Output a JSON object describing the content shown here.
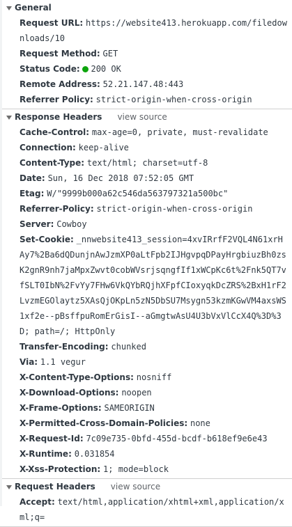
{
  "general": {
    "title": "General",
    "rows": [
      {
        "key": "Request URL:",
        "value": "https://website413.herokuapp.com/filedownloads/10"
      },
      {
        "key": "Request Method:",
        "value": "GET"
      },
      {
        "key": "Status Code:",
        "value": "200 OK"
      },
      {
        "key": "Remote Address:",
        "value": "52.21.147.48:443"
      },
      {
        "key": "Referrer Policy:",
        "value": "strict-origin-when-cross-origin"
      }
    ]
  },
  "response_headers": {
    "title": "Response Headers",
    "view_source": "view source",
    "rows": [
      {
        "key": "Cache-Control:",
        "value": "max-age=0, private, must-revalidate"
      },
      {
        "key": "Connection:",
        "value": "keep-alive"
      },
      {
        "key": "Content-Type:",
        "value": "text/html; charset=utf-8"
      },
      {
        "key": "Date:",
        "value": "Sun, 16 Dec 2018 07:52:05 GMT"
      },
      {
        "key": "Etag:",
        "value": "W/\"9999b000a62c546da563797321a500bc\""
      },
      {
        "key": "Referrer-Policy:",
        "value": "strict-origin-when-cross-origin"
      },
      {
        "key": "Server:",
        "value": "Cowboy"
      },
      {
        "key": "Set-Cookie:",
        "value": "_nnwebsite413_session=4xvIRrfF2VQL4N61xrHAy7%2Ba6dQDunjnAwJzmXP0aLtFpb2IJHgvpqDPayHrgbiuzBh0zsK2gnR9nh7jaMpxZwvt0cobWVsrjsqngfIf1xWCpKc6t%2Fnk5QT7vfSLT0IbN%2FvYy7FHw6VkQYbRQjhXFpfCIoxyqkDcZRS%2BxH1rF2LvzmEGOlaytz5XAsQjOKpLn5zN5DbSU7Msygn53kzmKGwVM4axsWS1xf2e--pBsffpuRomErGisI--aGmgtwAsU4U3bVxVlCcX4Q%3D%3D; path=/; HttpOnly"
      },
      {
        "key": "Transfer-Encoding:",
        "value": "chunked"
      },
      {
        "key": "Via:",
        "value": "1.1 vegur"
      },
      {
        "key": "X-Content-Type-Options:",
        "value": "nosniff"
      },
      {
        "key": "X-Download-Options:",
        "value": "noopen"
      },
      {
        "key": "X-Frame-Options:",
        "value": "SAMEORIGIN"
      },
      {
        "key": "X-Permitted-Cross-Domain-Policies:",
        "value": "none"
      },
      {
        "key": "X-Request-Id:",
        "value": "7c09e735-0bfd-455d-bcdf-b618ef9e6e43"
      },
      {
        "key": "X-Runtime:",
        "value": "0.031854"
      },
      {
        "key": "X-Xss-Protection:",
        "value": "1; mode=block"
      }
    ]
  },
  "request_headers": {
    "title": "Request Headers",
    "view_source": "view source",
    "rows": [
      {
        "key": "Accept:",
        "value": "text/html,application/xhtml+xml,application/xml;q="
      }
    ]
  },
  "colors": {
    "status_ok": "#0ca40c",
    "text": "#303942",
    "divider": "#d0d0d0"
  }
}
